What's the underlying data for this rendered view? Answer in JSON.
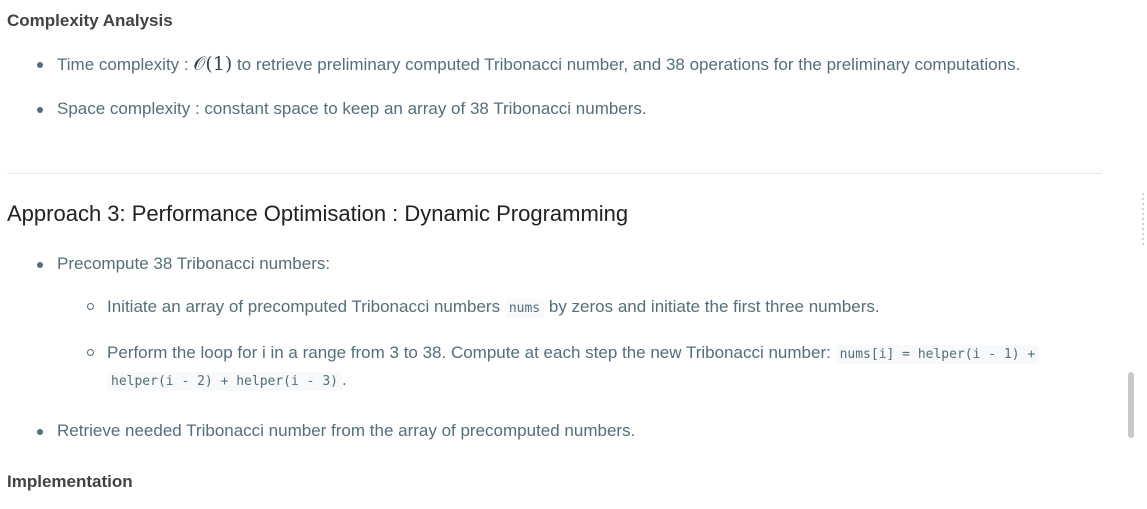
{
  "complexity": {
    "heading": "Complexity Analysis",
    "time": {
      "prefix": "Time complexity : ",
      "math": "𝒪(1)",
      "suffix": " to retrieve preliminary computed Tribonacci number, and 38 operations for the preliminary computations."
    },
    "space": "Space complexity : constant space to keep an array of 38 Tribonacci numbers."
  },
  "approach": {
    "title": "Approach 3: Performance Optimisation : Dynamic Programming",
    "precompute": "Precompute 38 Tribonacci numbers:",
    "initiate": {
      "prefix": "Initiate an array of precomputed Tribonacci numbers ",
      "code": "nums",
      "suffix": " by zeros and initiate the first three numbers."
    },
    "loop": {
      "prefix": "Perform the loop for i in a range from 3 to 38. Compute at each step the new Tribonacci number: ",
      "code1": "nums[i] = helper(i - 1) +",
      "code2": "helper(i - 2) + helper(i - 3)",
      "suffix": "."
    },
    "retrieve": "Retrieve needed Tribonacci number from the array of precomputed numbers.",
    "implementation": "Implementation"
  }
}
